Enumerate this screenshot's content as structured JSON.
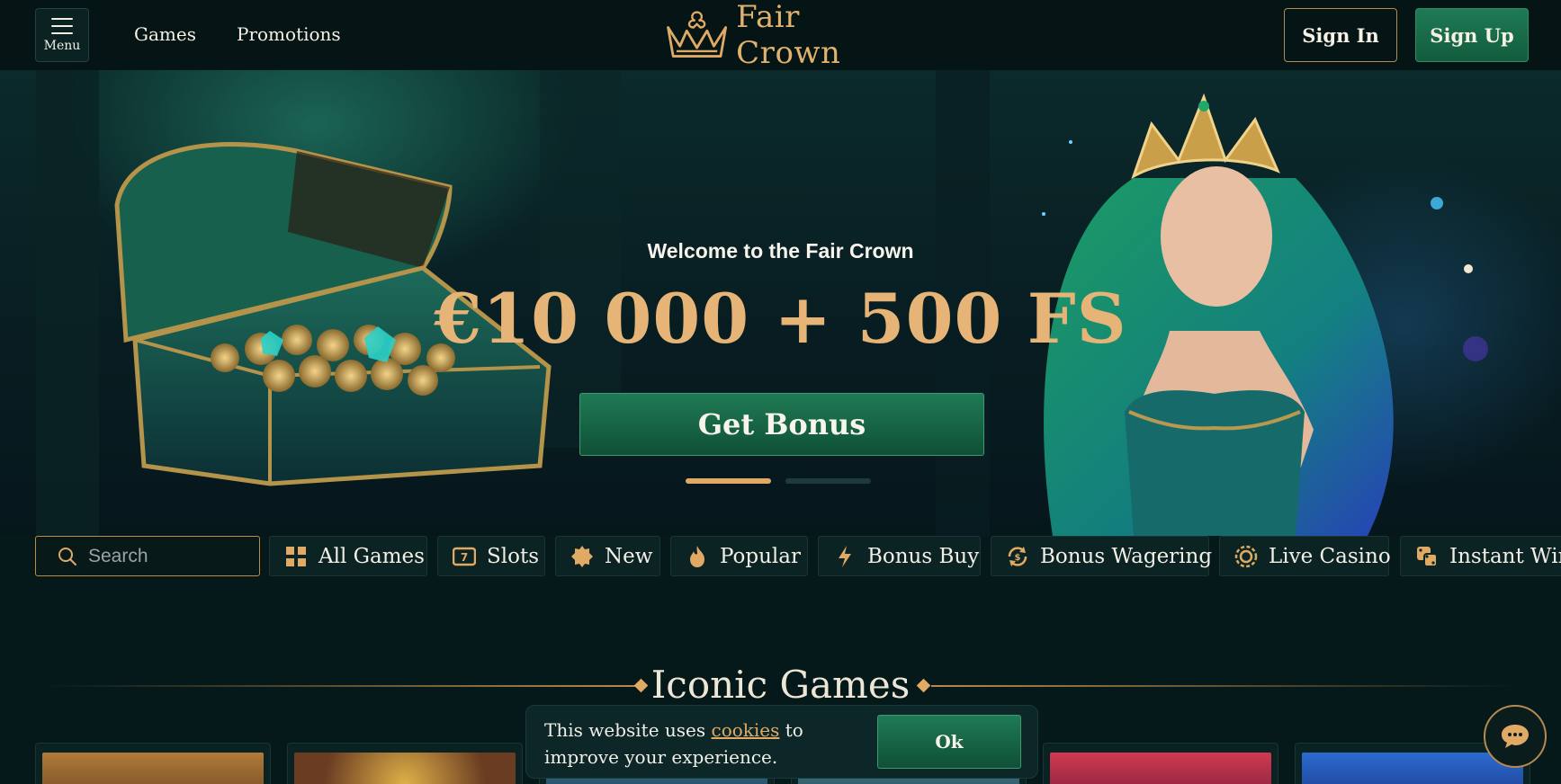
{
  "header": {
    "menu_label": "Menu",
    "nav": [
      {
        "label": "Games"
      },
      {
        "label": "Promotions"
      }
    ],
    "brand_name": "Fair Crown",
    "signin_label": "Sign In",
    "signup_label": "Sign Up"
  },
  "hero": {
    "welcome": "Welcome to the Fair Crown",
    "offer": "€10 000 + 500 FS",
    "cta_label": "Get Bonus",
    "carousel": {
      "slides": 2,
      "active_index": 0
    }
  },
  "filters": {
    "search_placeholder": "Search",
    "categories": [
      {
        "label": "All Games",
        "icon": "grid-icon"
      },
      {
        "label": "Slots",
        "icon": "slot-777-icon"
      },
      {
        "label": "New",
        "icon": "new-badge-icon"
      },
      {
        "label": "Popular",
        "icon": "flame-icon"
      },
      {
        "label": "Bonus Buy",
        "icon": "lightning-icon"
      },
      {
        "label": "Bonus Wagering",
        "icon": "coin-exchange-icon"
      },
      {
        "label": "Live Casino",
        "icon": "casino-chip-icon"
      },
      {
        "label": "Instant Win",
        "icon": "dice-icon"
      }
    ]
  },
  "iconic_games": {
    "title": "Iconic Games",
    "card_count": 6
  },
  "cookie_banner": {
    "text_before": "This website uses ",
    "link_text": "cookies",
    "text_after": " to improve your experience.",
    "ok_label": "Ok"
  },
  "colors": {
    "background": "#06191a",
    "header": "#051414",
    "gold": "#e0aa64",
    "green_button": "#1f7a55",
    "offer_text": "#e6b476"
  }
}
